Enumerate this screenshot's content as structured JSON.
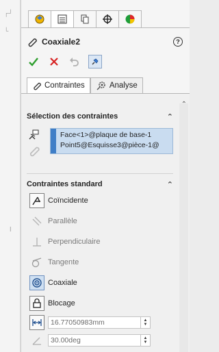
{
  "toolbar": {
    "tabs": [
      {
        "name": "feature-manager",
        "icon": "feature-tree-icon"
      },
      {
        "name": "property-manager",
        "icon": "property-manager-icon",
        "active": true
      },
      {
        "name": "configuration-manager",
        "icon": "configuration-icon"
      },
      {
        "name": "dimxpert-manager",
        "icon": "crosshair-icon"
      },
      {
        "name": "display-manager",
        "icon": "appearance-icon"
      }
    ]
  },
  "header": {
    "title": "Coaxiale2",
    "help": "?"
  },
  "tabs": {
    "constraints": "Contraintes",
    "analysis": "Analyse"
  },
  "selection": {
    "heading": "Sélection des contraintes",
    "items": [
      "Face<1>@plaque de base-1",
      "Point5@Esquisse3@pièce-1@"
    ]
  },
  "standard": {
    "heading": "Contraintes standard",
    "items": [
      {
        "label": "Coïncidente",
        "enabled": true,
        "selected": false
      },
      {
        "label": "Parallèle",
        "enabled": false,
        "selected": false
      },
      {
        "label": "Perpendiculaire",
        "enabled": false,
        "selected": false
      },
      {
        "label": "Tangente",
        "enabled": false,
        "selected": false
      },
      {
        "label": "Coaxiale",
        "enabled": true,
        "selected": true
      },
      {
        "label": "Blocage",
        "enabled": true,
        "selected": false
      }
    ],
    "distance_value": "16.77050983mm",
    "angle_value": "30.00deg"
  },
  "colors": {
    "selection_fill": "#c9dcf0",
    "selection_strip": "#3f7ec7",
    "accept_green": "#2e9e2e",
    "cancel_red": "#d62020"
  }
}
